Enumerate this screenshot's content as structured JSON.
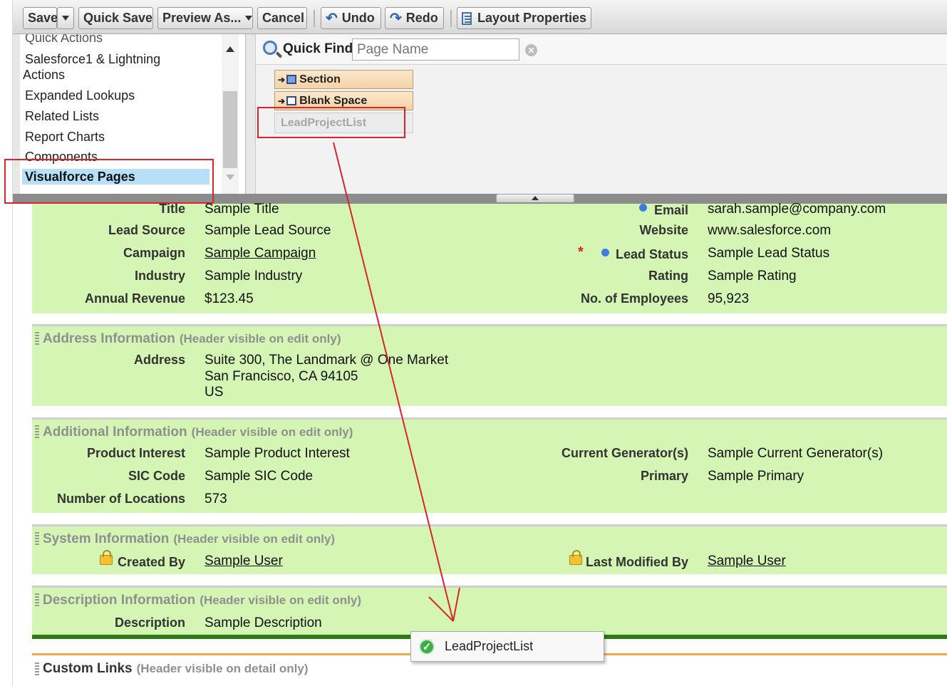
{
  "toolbar": {
    "save": "Save",
    "quick_save": "Quick Save",
    "preview_as": "Preview As...",
    "cancel": "Cancel",
    "undo": "Undo",
    "redo": "Redo",
    "layout_properties": "Layout Properties"
  },
  "palette": {
    "categories": [
      {
        "label": "Quick Actions",
        "icon": ""
      },
      {
        "label": "Salesforce1 & Lightning",
        "icon": ""
      },
      {
        "label": "Actions",
        "icon": ""
      },
      {
        "label": "Expanded Lookups",
        "icon": ""
      },
      {
        "label": "Related Lists",
        "icon": ""
      },
      {
        "label": "Report Charts",
        "icon": ""
      },
      {
        "label": "Components",
        "icon": ""
      },
      {
        "label": "Visualforce Pages",
        "icon": ""
      }
    ],
    "selected_category": "Visualforce Pages",
    "quick_find_label": "Quick Find",
    "quick_find_placeholder": "Page Name",
    "items": [
      {
        "label": "Section",
        "icon": "section-icon"
      },
      {
        "label": "Blank Space",
        "icon": "blank-space-icon"
      },
      {
        "label": "LeadProjectList",
        "icon": ""
      }
    ]
  },
  "lead_fields": {
    "left": [
      {
        "label": "Title",
        "value": "Sample Title"
      },
      {
        "label": "Lead Source",
        "value": "Sample Lead Source"
      },
      {
        "label": "Campaign",
        "value": "Sample Campaign"
      },
      {
        "label": "Industry",
        "value": "Sample Industry"
      },
      {
        "label": "Annual Revenue",
        "value": "$123.45"
      }
    ],
    "right": [
      {
        "label": "Email",
        "value": "sarah.sample@company.com"
      },
      {
        "label": "Website",
        "value": "www.salesforce.com"
      },
      {
        "label": "Lead Status",
        "value": "Sample Lead Status"
      },
      {
        "label": "Rating",
        "value": "Sample Rating"
      },
      {
        "label": "No. of Employees",
        "value": "95,923"
      }
    ]
  },
  "address_section": {
    "title": "Address Information",
    "subtitle": "(Header visible on edit only)",
    "label": "Address",
    "line1": "Suite 300, The Landmark @ One Market",
    "line2": "San Francisco, CA 94105",
    "line3": "US"
  },
  "additional_section": {
    "title": "Additional Information",
    "subtitle": "(Header visible on edit only)",
    "left": [
      {
        "label": "Product Interest",
        "value": "Sample Product Interest"
      },
      {
        "label": "SIC Code",
        "value": "Sample SIC Code"
      },
      {
        "label": "Number of Locations",
        "value": "573"
      }
    ],
    "right": [
      {
        "label": "Current Generator(s)",
        "value": "Sample Current Generator(s)"
      },
      {
        "label": "Primary",
        "value": "Sample Primary"
      }
    ]
  },
  "system_section": {
    "title": "System Information",
    "subtitle": "(Header visible on edit only)",
    "created_by_label": "Created By",
    "created_by_value": "Sample User",
    "last_modified_label": "Last Modified By",
    "last_modified_value": "Sample User"
  },
  "description_section": {
    "title": "Description Information",
    "subtitle": "(Header visible on edit only)",
    "label": "Description",
    "value": "Sample Description"
  },
  "custom_links": {
    "title": "Custom Links",
    "subtitle": "(Header visible on detail only)"
  },
  "drag_proxy": {
    "label": "LeadProjectList",
    "icon": "check-icon"
  },
  "colors": {
    "section_bg": "#d4f5b4",
    "highlight_red": "#d9242d",
    "drop_line": "#2f7a12",
    "selected_bg": "#b5e0f7"
  }
}
